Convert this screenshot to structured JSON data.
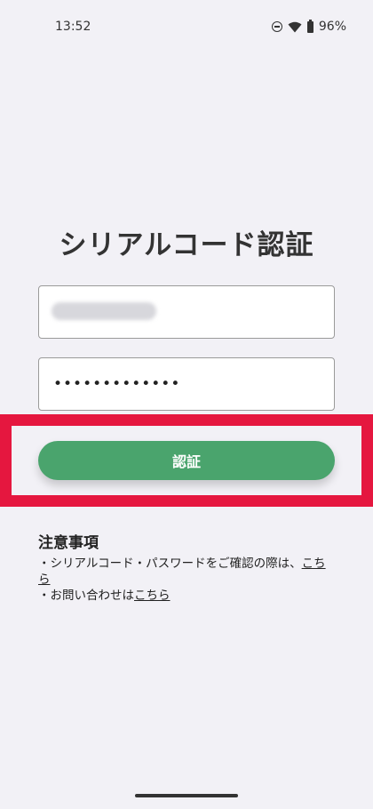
{
  "status_bar": {
    "time": "13:52",
    "battery_percent": "96%",
    "icons": [
      "do-not-disturb-icon",
      "wifi-icon",
      "battery-icon"
    ]
  },
  "page": {
    "title": "シリアルコード認証"
  },
  "form": {
    "serial_value": "",
    "password_value": "•••••••••••••"
  },
  "auth_button": {
    "label": "認証",
    "color": "#4aa46d"
  },
  "highlight": {
    "color": "#e5173f"
  },
  "notes": {
    "heading": "注意事項",
    "line1_text": "・シリアルコード・パスワードをご確認の際は、",
    "line1_link": "こちら",
    "line2_text": "・お問い合わせは",
    "line2_link": "こちら"
  }
}
